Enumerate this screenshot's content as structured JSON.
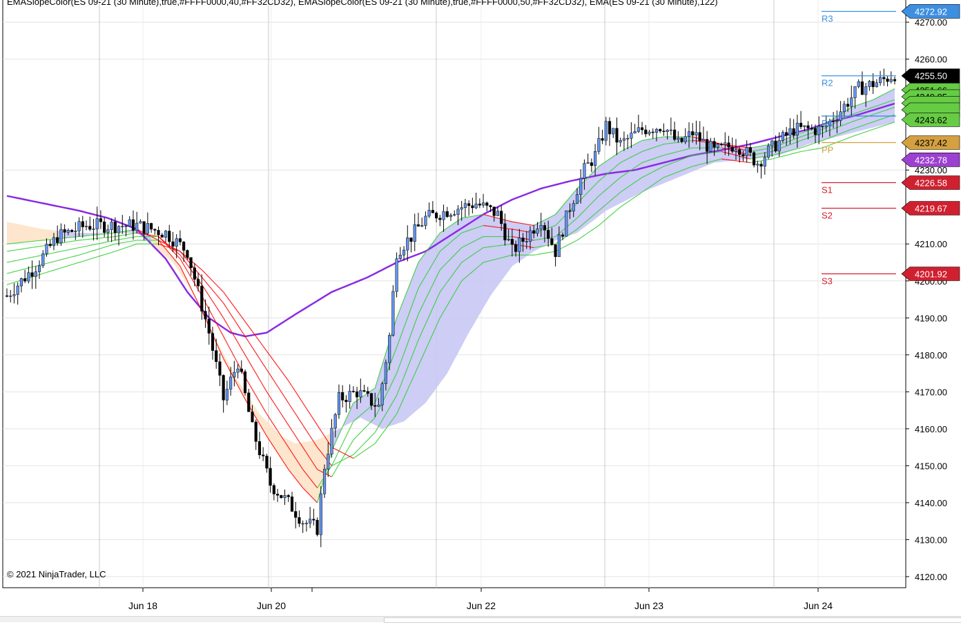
{
  "header": {
    "indicators": "EMASlopeColor(ES 09-21 (30 Minute),true,#FFFF0000,40,#FF32CD32), EMASlopeColor(ES 09-21 (30 Minute),true,#FFFF0000,50,#FF32CD32), EMA(ES 09-21 (30 Minute),122)"
  },
  "footer": {
    "copyright": "© 2021 NinjaTrader, LLC"
  },
  "colors": {
    "price": "#000000",
    "up_candle": "#6495ED",
    "ema122": "#8A2BE2",
    "slope_down": "#FF0000",
    "slope_up": "#32CD32",
    "cloud_bull": "#C8C8F5",
    "cloud_bear": "#FDE3C8",
    "pivot_resistance": "#3D8FE0",
    "pivot_pp": "#D4A040",
    "pivot_support": "#D02030"
  },
  "chart_data": {
    "type": "candlestick",
    "instrument": "ES 09-21 (30 Minute)",
    "ylim": [
      4117,
      4276
    ],
    "y_ticks": [
      4120,
      4130,
      4140,
      4150,
      4160,
      4170,
      4180,
      4190,
      4200,
      4210,
      4230,
      4260,
      4270
    ],
    "y_tick_labels": [
      "4120.00",
      "4130.00",
      "4140.00",
      "4150.00",
      "4160.00",
      "4170.00",
      "4180.00",
      "4190.00",
      "4200.00",
      "4210.00",
      "4230.00",
      "4260.00",
      "4270.00"
    ],
    "x_labels": [
      "Jun 18",
      "Jun 20",
      "Jun 22",
      "Jun 23",
      "Jun 24"
    ],
    "price_path": [
      [
        0,
        4196
      ],
      [
        8,
        4204
      ],
      [
        14,
        4212
      ],
      [
        22,
        4215
      ],
      [
        36,
        4215
      ],
      [
        44,
        4213
      ],
      [
        50,
        4208
      ],
      [
        56,
        4186
      ],
      [
        60,
        4168
      ],
      [
        64,
        4178
      ],
      [
        68,
        4160
      ],
      [
        73,
        4145
      ],
      [
        78,
        4140
      ],
      [
        82,
        4135
      ],
      [
        86,
        4133
      ],
      [
        88,
        4150
      ],
      [
        92,
        4168
      ],
      [
        97,
        4170
      ],
      [
        103,
        4166
      ],
      [
        106,
        4185
      ],
      [
        108,
        4208
      ],
      [
        112,
        4212
      ],
      [
        116,
        4217
      ],
      [
        122,
        4219
      ],
      [
        130,
        4221
      ],
      [
        136,
        4218
      ],
      [
        140,
        4208
      ],
      [
        144,
        4212
      ],
      [
        148,
        4217
      ],
      [
        152,
        4208
      ],
      [
        156,
        4220
      ],
      [
        160,
        4230
      ],
      [
        163,
        4234
      ],
      [
        166,
        4242
      ],
      [
        170,
        4237
      ],
      [
        176,
        4241
      ],
      [
        182,
        4242
      ],
      [
        186,
        4237
      ],
      [
        190,
        4240
      ],
      [
        196,
        4235
      ],
      [
        202,
        4237
      ],
      [
        208,
        4232
      ],
      [
        212,
        4236
      ],
      [
        218,
        4241
      ],
      [
        226,
        4241
      ],
      [
        230,
        4245
      ],
      [
        236,
        4252
      ],
      [
        242,
        4254
      ],
      [
        246,
        4256
      ]
    ],
    "ema122_path": [
      [
        0,
        4223
      ],
      [
        10,
        4221
      ],
      [
        20,
        4219
      ],
      [
        28,
        4217
      ],
      [
        36,
        4214
      ],
      [
        44,
        4206
      ],
      [
        50,
        4197
      ],
      [
        56,
        4190
      ],
      [
        62,
        4186
      ],
      [
        66,
        4185
      ],
      [
        72,
        4186
      ],
      [
        80,
        4191
      ],
      [
        90,
        4197
      ],
      [
        100,
        4201
      ],
      [
        108,
        4205
      ],
      [
        116,
        4208
      ],
      [
        124,
        4213
      ],
      [
        132,
        4218
      ],
      [
        140,
        4222
      ],
      [
        148,
        4225
      ],
      [
        156,
        4227
      ],
      [
        166,
        4229
      ],
      [
        174,
        4230
      ],
      [
        182,
        4232
      ],
      [
        190,
        4234
      ],
      [
        196,
        4235
      ],
      [
        206,
        4237
      ],
      [
        214,
        4239
      ],
      [
        222,
        4241
      ],
      [
        228,
        4243
      ],
      [
        236,
        4245
      ],
      [
        246,
        4248
      ]
    ],
    "slope_emas": [
      [
        [
          0,
          4210
        ],
        [
          20,
          4212
        ],
        [
          30,
          4213
        ],
        [
          36,
          4214
        ],
        [
          42,
          4211
        ],
        [
          48,
          4204
        ],
        [
          54,
          4192
        ],
        [
          60,
          4179
        ],
        [
          66,
          4168
        ],
        [
          72,
          4158
        ],
        [
          78,
          4149
        ],
        [
          82,
          4144
        ],
        [
          86,
          4140
        ],
        [
          90,
          4154
        ],
        [
          96,
          4167
        ],
        [
          102,
          4171
        ],
        [
          108,
          4190
        ],
        [
          114,
          4205
        ],
        [
          120,
          4213
        ],
        [
          126,
          4217
        ],
        [
          132,
          4218
        ],
        [
          140,
          4216
        ],
        [
          146,
          4215
        ],
        [
          152,
          4218
        ],
        [
          158,
          4225
        ],
        [
          164,
          4231
        ],
        [
          170,
          4235
        ],
        [
          176,
          4238
        ],
        [
          182,
          4239
        ],
        [
          190,
          4239
        ],
        [
          198,
          4237
        ],
        [
          206,
          4236
        ],
        [
          212,
          4237
        ],
        [
          220,
          4240
        ],
        [
          226,
          4242
        ],
        [
          234,
          4247
        ],
        [
          240,
          4249
        ],
        [
          246,
          4252
        ]
      ],
      [
        [
          0,
          4208
        ],
        [
          20,
          4211
        ],
        [
          30,
          4212
        ],
        [
          36,
          4213
        ],
        [
          42,
          4212
        ],
        [
          48,
          4206
        ],
        [
          54,
          4196
        ],
        [
          60,
          4185
        ],
        [
          66,
          4174
        ],
        [
          72,
          4164
        ],
        [
          78,
          4155
        ],
        [
          82,
          4149
        ],
        [
          86,
          4144
        ],
        [
          90,
          4150
        ],
        [
          96,
          4162
        ],
        [
          102,
          4167
        ],
        [
          108,
          4182
        ],
        [
          114,
          4198
        ],
        [
          120,
          4208
        ],
        [
          126,
          4213
        ],
        [
          132,
          4215
        ],
        [
          140,
          4214
        ],
        [
          146,
          4213
        ],
        [
          152,
          4215
        ],
        [
          158,
          4221
        ],
        [
          164,
          4227
        ],
        [
          170,
          4232
        ],
        [
          176,
          4235
        ],
        [
          182,
          4237
        ],
        [
          190,
          4238
        ],
        [
          198,
          4237
        ],
        [
          206,
          4235
        ],
        [
          212,
          4236
        ],
        [
          220,
          4239
        ],
        [
          226,
          4241
        ],
        [
          234,
          4245
        ],
        [
          240,
          4247
        ],
        [
          246,
          4249
        ]
      ],
      [
        [
          0,
          4205
        ],
        [
          20,
          4209
        ],
        [
          30,
          4211
        ],
        [
          36,
          4212
        ],
        [
          42,
          4212
        ],
        [
          48,
          4207
        ],
        [
          54,
          4199
        ],
        [
          60,
          4190
        ],
        [
          66,
          4180
        ],
        [
          72,
          4170
        ],
        [
          78,
          4161
        ],
        [
          82,
          4155
        ],
        [
          86,
          4149
        ],
        [
          90,
          4147
        ],
        [
          96,
          4157
        ],
        [
          102,
          4163
        ],
        [
          108,
          4175
        ],
        [
          114,
          4191
        ],
        [
          120,
          4203
        ],
        [
          126,
          4209
        ],
        [
          132,
          4212
        ],
        [
          140,
          4212
        ],
        [
          146,
          4211
        ],
        [
          152,
          4212
        ],
        [
          158,
          4217
        ],
        [
          164,
          4223
        ],
        [
          170,
          4228
        ],
        [
          176,
          4232
        ],
        [
          182,
          4234
        ],
        [
          190,
          4236
        ],
        [
          198,
          4236
        ],
        [
          206,
          4234
        ],
        [
          212,
          4235
        ],
        [
          220,
          4238
        ],
        [
          226,
          4240
        ],
        [
          234,
          4243
        ],
        [
          240,
          4245
        ],
        [
          246,
          4247
        ]
      ],
      [
        [
          0,
          4202
        ],
        [
          20,
          4207
        ],
        [
          30,
          4210
        ],
        [
          36,
          4211
        ],
        [
          42,
          4211
        ],
        [
          48,
          4208
        ],
        [
          54,
          4201
        ],
        [
          60,
          4194
        ],
        [
          66,
          4185
        ],
        [
          72,
          4176
        ],
        [
          78,
          4167
        ],
        [
          82,
          4161
        ],
        [
          86,
          4155
        ],
        [
          90,
          4150
        ],
        [
          96,
          4153
        ],
        [
          102,
          4159
        ],
        [
          108,
          4169
        ],
        [
          114,
          4184
        ],
        [
          120,
          4197
        ],
        [
          126,
          4205
        ],
        [
          132,
          4209
        ],
        [
          140,
          4210
        ],
        [
          146,
          4209
        ],
        [
          152,
          4210
        ],
        [
          158,
          4214
        ],
        [
          164,
          4219
        ],
        [
          170,
          4224
        ],
        [
          176,
          4228
        ],
        [
          182,
          4231
        ],
        [
          190,
          4234
        ],
        [
          198,
          4235
        ],
        [
          206,
          4233
        ],
        [
          212,
          4234
        ],
        [
          220,
          4236
        ],
        [
          226,
          4238
        ],
        [
          234,
          4241
        ],
        [
          240,
          4243
        ],
        [
          246,
          4245
        ]
      ],
      [
        [
          0,
          4199
        ],
        [
          20,
          4205
        ],
        [
          30,
          4208
        ],
        [
          36,
          4210
        ],
        [
          42,
          4210
        ],
        [
          48,
          4208
        ],
        [
          54,
          4203
        ],
        [
          60,
          4197
        ],
        [
          66,
          4189
        ],
        [
          72,
          4181
        ],
        [
          78,
          4173
        ],
        [
          82,
          4167
        ],
        [
          86,
          4161
        ],
        [
          90,
          4155
        ],
        [
          96,
          4152
        ],
        [
          102,
          4156
        ],
        [
          108,
          4164
        ],
        [
          114,
          4177
        ],
        [
          120,
          4190
        ],
        [
          126,
          4200
        ],
        [
          132,
          4205
        ],
        [
          140,
          4207
        ],
        [
          146,
          4207
        ],
        [
          152,
          4208
        ],
        [
          158,
          4211
        ],
        [
          164,
          4215
        ],
        [
          170,
          4220
        ],
        [
          176,
          4224
        ],
        [
          182,
          4228
        ],
        [
          190,
          4231
        ],
        [
          198,
          4233
        ],
        [
          206,
          4232
        ],
        [
          212,
          4233
        ],
        [
          220,
          4235
        ],
        [
          226,
          4236
        ],
        [
          234,
          4239
        ],
        [
          240,
          4241
        ],
        [
          246,
          4243
        ]
      ]
    ],
    "cloud_outer": [
      [
        0,
        4216
      ],
      [
        10,
        4214
      ],
      [
        20,
        4213
      ],
      [
        30,
        4213
      ],
      [
        36,
        4213
      ],
      [
        40,
        4210
      ],
      [
        46,
        4205
      ],
      [
        52,
        4196
      ],
      [
        58,
        4184
      ],
      [
        64,
        4173
      ],
      [
        70,
        4164
      ],
      [
        76,
        4158
      ],
      [
        80,
        4156
      ],
      [
        86,
        4157
      ],
      [
        92,
        4160
      ],
      [
        98,
        4163
      ],
      [
        104,
        4160
      ],
      [
        110,
        4162
      ],
      [
        116,
        4167
      ],
      [
        122,
        4175
      ],
      [
        128,
        4186
      ],
      [
        134,
        4196
      ],
      [
        140,
        4204
      ],
      [
        146,
        4208
      ],
      [
        152,
        4211
      ],
      [
        158,
        4213
      ],
      [
        166,
        4219
      ],
      [
        176,
        4224
      ],
      [
        186,
        4228
      ],
      [
        196,
        4232
      ],
      [
        206,
        4233
      ],
      [
        214,
        4234
      ],
      [
        222,
        4237
      ],
      [
        230,
        4239
      ],
      [
        238,
        4241
      ],
      [
        246,
        4243
      ]
    ],
    "pivots": [
      {
        "label": "R3",
        "value": 4272.92,
        "text": "4272.92"
      },
      {
        "label": "R2",
        "value": 4255.5,
        "text": ""
      },
      {
        "label": "R1",
        "value": 4244.6,
        "text": ""
      },
      {
        "label": "PP",
        "value": 4237.42,
        "text": "4237.42"
      },
      {
        "label": "S1",
        "value": 4226.58,
        "text": "4226.58"
      },
      {
        "label": "S2",
        "value": 4219.67,
        "text": "4219.67"
      },
      {
        "label": "S3",
        "value": 4201.92,
        "text": "4201.92"
      }
    ],
    "price_markers": [
      {
        "value": 4255.5,
        "text": "4255.50",
        "color": "#000000",
        "text_color": "#ffffff"
      },
      {
        "value": 4251.66,
        "text": "4251.66",
        "color": "#66CC44",
        "text_color": "#000000"
      },
      {
        "value": 4249.85,
        "text": "4249.85",
        "color": "#66CC44",
        "text_color": "#000000"
      },
      {
        "value": 4248.1,
        "text": "",
        "color": "#66CC44",
        "text_color": "#000000"
      },
      {
        "value": 4246.3,
        "text": "",
        "color": "#66CC44",
        "text_color": "#000000"
      },
      {
        "value": 4243.62,
        "text": "4243.62",
        "color": "#66CC44",
        "text_color": "#000000"
      },
      {
        "value": 4237.42,
        "text": "4237.42",
        "color": "#D4A040",
        "text_color": "#000000"
      },
      {
        "value": 4232.78,
        "text": "4232.78",
        "color": "#9B40D0",
        "text_color": "#ffffff"
      },
      {
        "value": 4226.58,
        "text": "4226.58",
        "color": "#D02030",
        "text_color": "#ffffff"
      },
      {
        "value": 4219.67,
        "text": "4219.67",
        "color": "#D02030",
        "text_color": "#ffffff"
      },
      {
        "value": 4201.92,
        "text": "4201.92",
        "color": "#D02030",
        "text_color": "#ffffff"
      },
      {
        "value": 4272.92,
        "text": "4272.92",
        "color": "#3D8FE0",
        "text_color": "#ffffff"
      }
    ]
  }
}
